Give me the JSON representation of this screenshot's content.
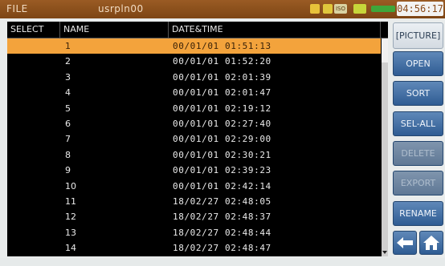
{
  "topbar": {
    "app_title": "FILE",
    "file_name": "usrpln00",
    "indicator_label": "ISO",
    "clock": "04:56:17"
  },
  "table": {
    "headers": {
      "select": "SELECT",
      "name": "NAME",
      "date": "DATE&TIME"
    },
    "rows": [
      {
        "name": "1",
        "date": "00/01/01  01:51:13",
        "selected": true
      },
      {
        "name": "2",
        "date": "00/01/01  01:52:20"
      },
      {
        "name": "3",
        "date": "00/01/01  02:01:39"
      },
      {
        "name": "4",
        "date": "00/01/01  02:01:47"
      },
      {
        "name": "5",
        "date": "00/01/01  02:19:12"
      },
      {
        "name": "6",
        "date": "00/01/01  02:27:40"
      },
      {
        "name": "7",
        "date": "00/01/01  02:29:00"
      },
      {
        "name": "8",
        "date": "00/01/01  02:30:21"
      },
      {
        "name": "9",
        "date": "00/01/01  02:39:23"
      },
      {
        "name": "10",
        "date": "00/01/01  02:42:14"
      },
      {
        "name": "11",
        "date": "18/02/27  02:48:05"
      },
      {
        "name": "12",
        "date": "18/02/27  02:48:37"
      },
      {
        "name": "13",
        "date": "18/02/27  02:48:44"
      },
      {
        "name": "14",
        "date": "18/02/27  02:48:47"
      }
    ]
  },
  "buttons": {
    "picture": "[PICTURE]",
    "open": "OPEN",
    "sort": "SORT",
    "sel_all": "SEL-ALL",
    "delete": "DELETE",
    "export": "EXPORT",
    "rename": "RENAME",
    "back_icon": "left-arrow-icon",
    "home_icon": "home-icon"
  },
  "colors": {
    "topbar": "#8a4f1c",
    "selected_row": "#f3a33c",
    "button_blue": "#3f6aa0"
  }
}
